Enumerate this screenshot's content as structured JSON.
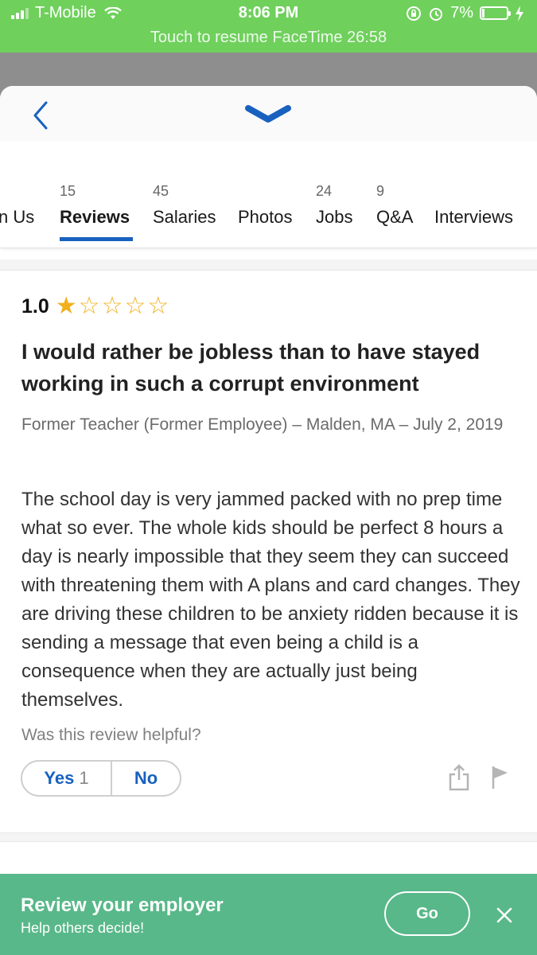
{
  "status_bar": {
    "carrier": "T-Mobile",
    "time": "8:06 PM",
    "battery": "7%",
    "banner": "Touch to resume FaceTime 26:58",
    "icons": [
      "signal-icon",
      "wifi-icon",
      "rotation-lock-icon",
      "alarm-icon",
      "battery-icon",
      "charging-icon"
    ]
  },
  "header": {
    "back_icon": "chevron-left-icon",
    "dismiss_icon": "chevron-down-icon"
  },
  "tabs": [
    {
      "count": "",
      "label": "n Us"
    },
    {
      "count": "15",
      "label": "Reviews",
      "active": true
    },
    {
      "count": "45",
      "label": "Salaries"
    },
    {
      "count": "",
      "label": "Photos"
    },
    {
      "count": "24",
      "label": "Jobs"
    },
    {
      "count": "9",
      "label": "Q&A"
    },
    {
      "count": "",
      "label": "Interviews"
    }
  ],
  "review": {
    "rating": "1.0",
    "stars_filled": 1,
    "stars_total": 5,
    "title": "I would rather be jobless than to have stayed working in such a corrupt environment",
    "meta": "Former Teacher (Former Employee) –  Malden, MA – July 2, 2019",
    "body": "The school day is very jammed packed with no prep time what so ever. The whole kids should be perfect 8 hours a day is nearly impossible that they seem they can succeed with threatening them with A plans and card changes. They are driving these children to be anxiety ridden because it is sending a message that even being a child is a consequence when they are actually just being themselves.",
    "helpful_question": "Was this review helpful?",
    "yes_label": "Yes",
    "yes_count": "1",
    "no_label": "No"
  },
  "banner": {
    "title": "Review your employer",
    "subtitle": "Help others decide!",
    "go_label": "Go"
  },
  "colors": {
    "status_green": "#6fd05c",
    "accent_blue": "#1861bf",
    "star_gold": "#f2b01e",
    "banner_green": "#58b889"
  }
}
